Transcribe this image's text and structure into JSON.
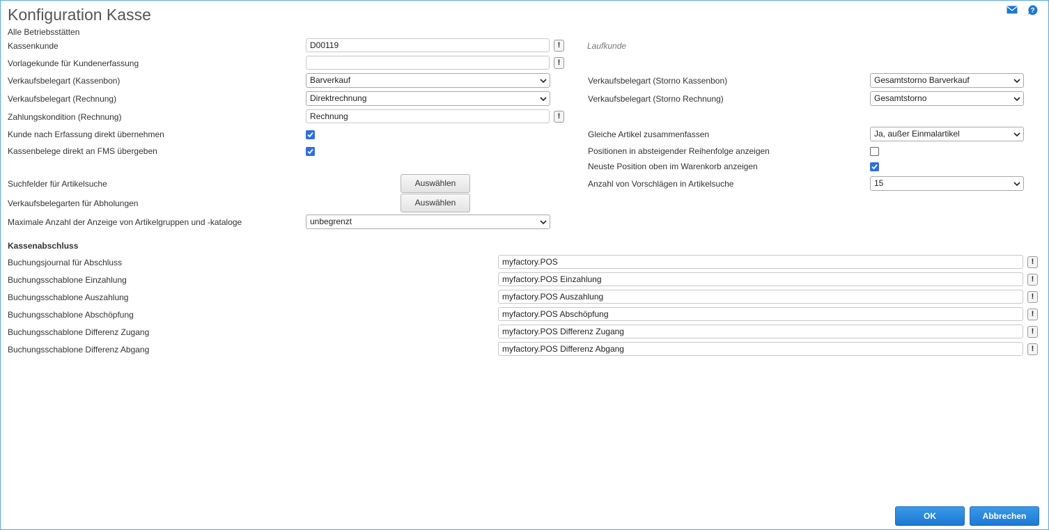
{
  "header": {
    "title": "Konfiguration Kasse",
    "subtitle": "Alle Betriebsstätten",
    "mail_icon": "mail-icon",
    "help_icon": "help-icon"
  },
  "left": {
    "kassenkunde": {
      "label": "Kassenkunde",
      "value": "D00119",
      "hint": "Laufkunde"
    },
    "vorlagekunde": {
      "label": "Vorlagekunde für Kundenerfassung",
      "value": ""
    },
    "verkauf_kassenbon": {
      "label": "Verkaufsbelegart (Kassenbon)",
      "value": "Barverkauf"
    },
    "verkauf_rechnung": {
      "label": "Verkaufsbelegart (Rechnung)",
      "value": "Direktrechnung"
    },
    "zahlungskondition": {
      "label": "Zahlungskondition (Rechnung)",
      "value": "Rechnung"
    },
    "kunde_uebernehmen": {
      "label": "Kunde nach Erfassung direkt übernehmen",
      "checked": true
    },
    "fms_uebergeben": {
      "label": "Kassenbelege direkt an FMS übergeben",
      "checked": true
    },
    "suchfelder": {
      "label": "Suchfelder für Artikelsuche",
      "button": "Auswählen"
    },
    "abholungen": {
      "label": "Verkaufsbelegarten für Abholungen",
      "button": "Auswählen"
    },
    "max_anzeige": {
      "label": "Maximale Anzahl der Anzeige von Artikelgruppen und -kataloge",
      "value": "unbegrenzt"
    }
  },
  "right": {
    "storno_kassenbon": {
      "label": "Verkaufsbelegart (Storno Kassenbon)",
      "value": "Gesamtstorno Barverkauf"
    },
    "storno_rechnung": {
      "label": "Verkaufsbelegart (Storno Rechnung)",
      "value": "Gesamtstorno"
    },
    "gleiche_artikel": {
      "label": "Gleiche Artikel zusammenfassen",
      "value": "Ja, außer Einmalartikel"
    },
    "absteigend": {
      "label": "Positionen in absteigender Reihenfolge anzeigen",
      "checked": false
    },
    "neuste_oben": {
      "label": "Neuste Position oben im Warenkorb anzeigen",
      "checked": true
    },
    "vorschlaege": {
      "label": "Anzahl von Vorschlägen in Artikelsuche",
      "value": "15"
    }
  },
  "kassenabschluss": {
    "heading": "Kassenabschluss",
    "rows": [
      {
        "label": "Buchungsjournal für Abschluss",
        "value": "myfactory.POS"
      },
      {
        "label": "Buchungsschablone Einzahlung",
        "value": "myfactory.POS Einzahlung"
      },
      {
        "label": "Buchungsschablone Auszahlung",
        "value": "myfactory.POS Auszahlung"
      },
      {
        "label": "Buchungsschablone Abschöpfung",
        "value": "myfactory.POS Abschöpfung"
      },
      {
        "label": "Buchungsschablone Differenz Zugang",
        "value": "myfactory.POS Differenz Zugang"
      },
      {
        "label": "Buchungsschablone Differenz Abgang",
        "value": "myfactory.POS Differenz Abgang"
      }
    ]
  },
  "footer": {
    "ok": "OK",
    "cancel": "Abbrechen"
  },
  "colors": {
    "accent": "#1d78d4",
    "checkbox": "#2f6fe0",
    "border": "#5aa9d6"
  }
}
